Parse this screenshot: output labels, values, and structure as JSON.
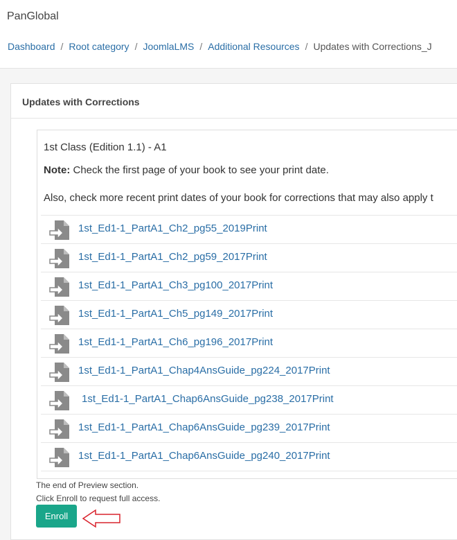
{
  "header": {
    "brand": "PanGlobal",
    "breadcrumb": [
      "Dashboard",
      "Root category",
      "JoomlaLMS",
      "Additional Resources",
      "Updates with Corrections_J"
    ]
  },
  "panel": {
    "title": "Updates with Corrections"
  },
  "content": {
    "class_title": "1st Class (Edition 1.1) - A1",
    "note_label": "Note:",
    "note_text": " Check the first page of your book to see your print date.",
    "also_text": "Also, check more recent print dates of your book for corrections that may also apply t",
    "files": [
      "1st_Ed1-1_PartA1_Ch2_pg55_2019Print",
      "1st_Ed1-1_PartA1_Ch2_pg59_2017Print",
      "1st_Ed1-1_PartA1_Ch3_pg100_2017Print",
      "1st_Ed1-1_PartA1_Ch5_pg149_2017Print",
      "1st_Ed1-1_PartA1_Ch6_pg196_2017Print",
      "1st_Ed1-1_PartA1_Chap4AnsGuide_pg224_2017Print",
      "1st_Ed1-1_PartA1_Chap6AnsGuide_pg238_2017Print",
      "1st_Ed1-1_PartA1_Chap6AnsGuide_pg239_2017Print",
      "1st_Ed1-1_PartA1_Chap6AnsGuide_pg240_2017Print"
    ],
    "file_icon": "file-import-icon"
  },
  "footer": {
    "end_line1": "The end of Preview section.",
    "end_line2": "Click Enroll to request full access.",
    "enroll_label": "Enroll",
    "annotation_icon": "red-arrow-left-icon"
  },
  "colors": {
    "link": "#2a6ea6",
    "enroll": "#1aa68a",
    "annotation": "#d9232d"
  }
}
